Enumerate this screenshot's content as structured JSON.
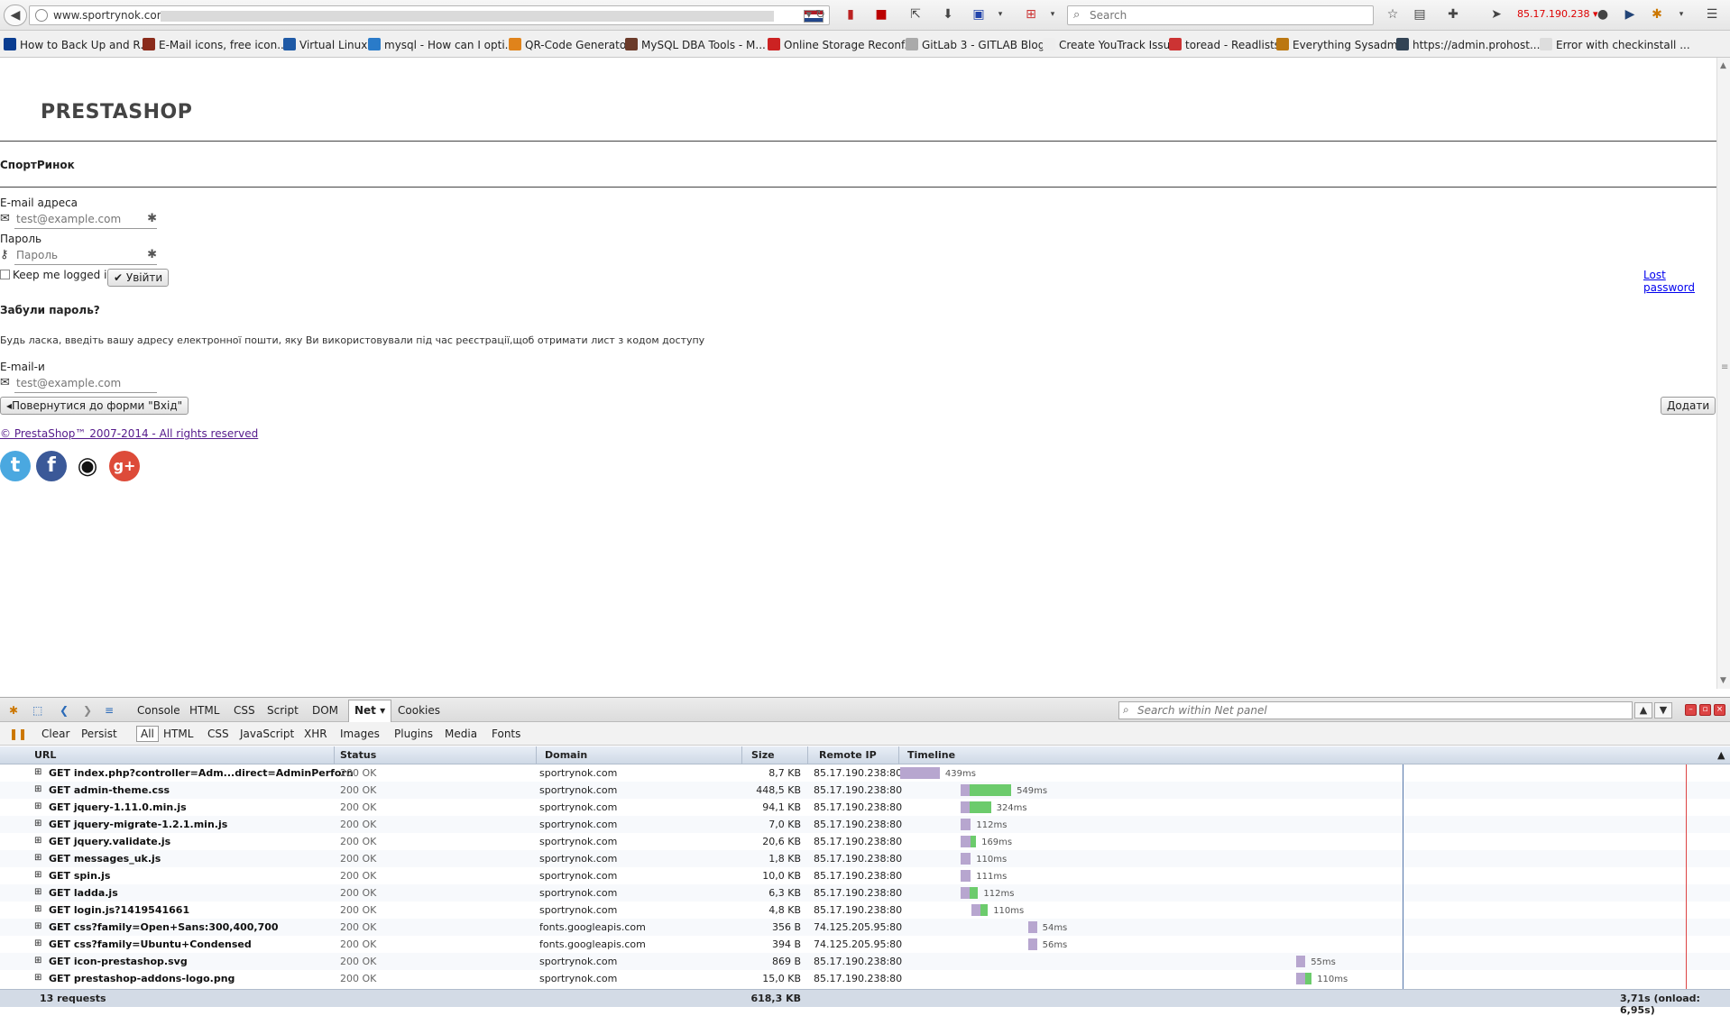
{
  "browser": {
    "url": "www.sportrynok.com/",
    "search_placeholder": "Search",
    "ip": "85.17.190.238 ▾"
  },
  "bookmarks": [
    {
      "label": "How to Back Up and R...",
      "color": "#0a3d91"
    },
    {
      "label": "E-Mail icons, free icon...",
      "color": "#8a2b1b"
    },
    {
      "label": "Virtual Linux",
      "color": "#1f5aa6"
    },
    {
      "label": "mysql - How can I opti...",
      "color": "#2a7bc9"
    },
    {
      "label": "QR-Code Generator",
      "color": "#e0831b"
    },
    {
      "label": "MySQL DBA Tools - M...",
      "color": "#6b3b2a"
    },
    {
      "label": "Online Storage Reconf...",
      "color": "#c22"
    },
    {
      "label": "GitLab 3 - GITLAB Blog",
      "color": "#aaa"
    },
    {
      "label": "Create YouTrack Issue",
      "color": "#eee"
    },
    {
      "label": "toread - Readlists",
      "color": "#c33"
    },
    {
      "label": "Everything Sysadmin",
      "color": "#b71"
    },
    {
      "label": "https://admin.prohost...",
      "color": "#345"
    },
    {
      "label": "Error with checkinstall ...",
      "color": "#ddd"
    }
  ],
  "page": {
    "brand": "PRESTASHOP",
    "shop_name": "СпортРинок",
    "email_label": "E-mail адреса",
    "email_placeholder": "test@example.com",
    "password_label": "Пароль",
    "password_placeholder": "Пароль",
    "keep_logged": "Keep me logged in",
    "login_button": "Увійти",
    "lost_password": "Lost password",
    "forgot_title": "Забули пароль?",
    "forgot_text": "Будь ласка, введіть вашу адресу електронної пошти, яку Ви використовували під час реєстрації,щоб отримати лист з кодом доступу",
    "forgot_email_label": "E-mail-и",
    "forgot_email_placeholder": "test@example.com",
    "back_button": "Повернутися до форми \"Вхід\"",
    "submit_button": "Додати",
    "copyright": "© PrestaShop™ 2007-2014 - All rights reserved",
    "social": [
      {
        "name": "twitter",
        "color": "#4aa8e0"
      },
      {
        "name": "facebook",
        "color": "#3b5998"
      },
      {
        "name": "github",
        "color": "#111"
      },
      {
        "name": "google-plus",
        "color": "#dd4b39"
      }
    ]
  },
  "firebug": {
    "tabs": [
      "Console",
      "HTML",
      "CSS",
      "Script",
      "DOM",
      "Net ▾",
      "Cookies"
    ],
    "active_tab": "Net ▾",
    "search_placeholder": "Search within Net panel",
    "filters": [
      "Clear",
      "Persist",
      "All",
      "HTML",
      "CSS",
      "JavaScript",
      "XHR",
      "Images",
      "Plugins",
      "Media",
      "Fonts"
    ],
    "active_filter": "All",
    "columns": [
      "URL",
      "Status",
      "Domain",
      "Size",
      "Remote IP",
      "Timeline"
    ],
    "requests": [
      {
        "url": "GET index.php?controller=Adm...direct=AdminPerforn",
        "status": "200 OK",
        "domain": "sportrynok.com",
        "size": "8,7 KB",
        "ip": "85.17.190.238:80",
        "start": 0,
        "wait": 439,
        "recv": 0,
        "time": "439ms"
      },
      {
        "url": "GET admin-theme.css",
        "status": "200 OK",
        "domain": "sportrynok.com",
        "size": "448,5 KB",
        "ip": "85.17.190.238:80",
        "start": 560,
        "wait": 90,
        "recv": 459,
        "time": "549ms"
      },
      {
        "url": "GET jquery-1.11.0.min.js",
        "status": "200 OK",
        "domain": "sportrynok.com",
        "size": "94,1 KB",
        "ip": "85.17.190.238:80",
        "start": 560,
        "wait": 90,
        "recv": 234,
        "time": "324ms"
      },
      {
        "url": "GET jquery-migrate-1.2.1.min.js",
        "status": "200 OK",
        "domain": "sportrynok.com",
        "size": "7,0 KB",
        "ip": "85.17.190.238:80",
        "start": 560,
        "wait": 112,
        "recv": 0,
        "time": "112ms"
      },
      {
        "url": "GET jquery.validate.js",
        "status": "200 OK",
        "domain": "sportrynok.com",
        "size": "20,6 KB",
        "ip": "85.17.190.238:80",
        "start": 560,
        "wait": 112,
        "recv": 57,
        "time": "169ms"
      },
      {
        "url": "GET messages_uk.js",
        "status": "200 OK",
        "domain": "sportrynok.com",
        "size": "1,8 KB",
        "ip": "85.17.190.238:80",
        "start": 560,
        "wait": 110,
        "recv": 0,
        "time": "110ms"
      },
      {
        "url": "GET spin.js",
        "status": "200 OK",
        "domain": "sportrynok.com",
        "size": "10,0 KB",
        "ip": "85.17.190.238:80",
        "start": 560,
        "wait": 111,
        "recv": 0,
        "time": "111ms"
      },
      {
        "url": "GET ladda.js",
        "status": "200 OK",
        "domain": "sportrynok.com",
        "size": "6,3 KB",
        "ip": "85.17.190.238:80",
        "start": 560,
        "wait": 20,
        "recv": 92,
        "time": "112ms"
      },
      {
        "url": "GET login.js?1419541661",
        "status": "200 OK",
        "domain": "sportrynok.com",
        "size": "4,8 KB",
        "ip": "85.17.190.238:80",
        "start": 660,
        "wait": 30,
        "recv": 80,
        "time": "110ms"
      },
      {
        "url": "GET css?family=Open+Sans:300,400,700",
        "status": "200 OK",
        "domain": "fonts.googleapis.com",
        "size": "356 B",
        "ip": "74.125.205.95:80",
        "start": 1180,
        "wait": 54,
        "recv": 0,
        "time": "54ms"
      },
      {
        "url": "GET css?family=Ubuntu+Condensed",
        "status": "200 OK",
        "domain": "fonts.googleapis.com",
        "size": "394 B",
        "ip": "74.125.205.95:80",
        "start": 1180,
        "wait": 56,
        "recv": 0,
        "time": "56ms"
      },
      {
        "url": "GET icon-prestashop.svg",
        "status": "200 OK",
        "domain": "sportrynok.com",
        "size": "869 B",
        "ip": "85.17.190.238:80",
        "start": 3660,
        "wait": 55,
        "recv": 0,
        "time": "55ms"
      },
      {
        "url": "GET prestashop-addons-logo.png",
        "status": "200 OK",
        "domain": "sportrynok.com",
        "size": "15,0 KB",
        "ip": "85.17.190.238:80",
        "start": 3660,
        "wait": 40,
        "recv": 70,
        "time": "110ms"
      }
    ],
    "summary": {
      "count": "13 requests",
      "total_size": "618,3 KB",
      "time": "3,71s (onload: 6,95s)"
    }
  }
}
